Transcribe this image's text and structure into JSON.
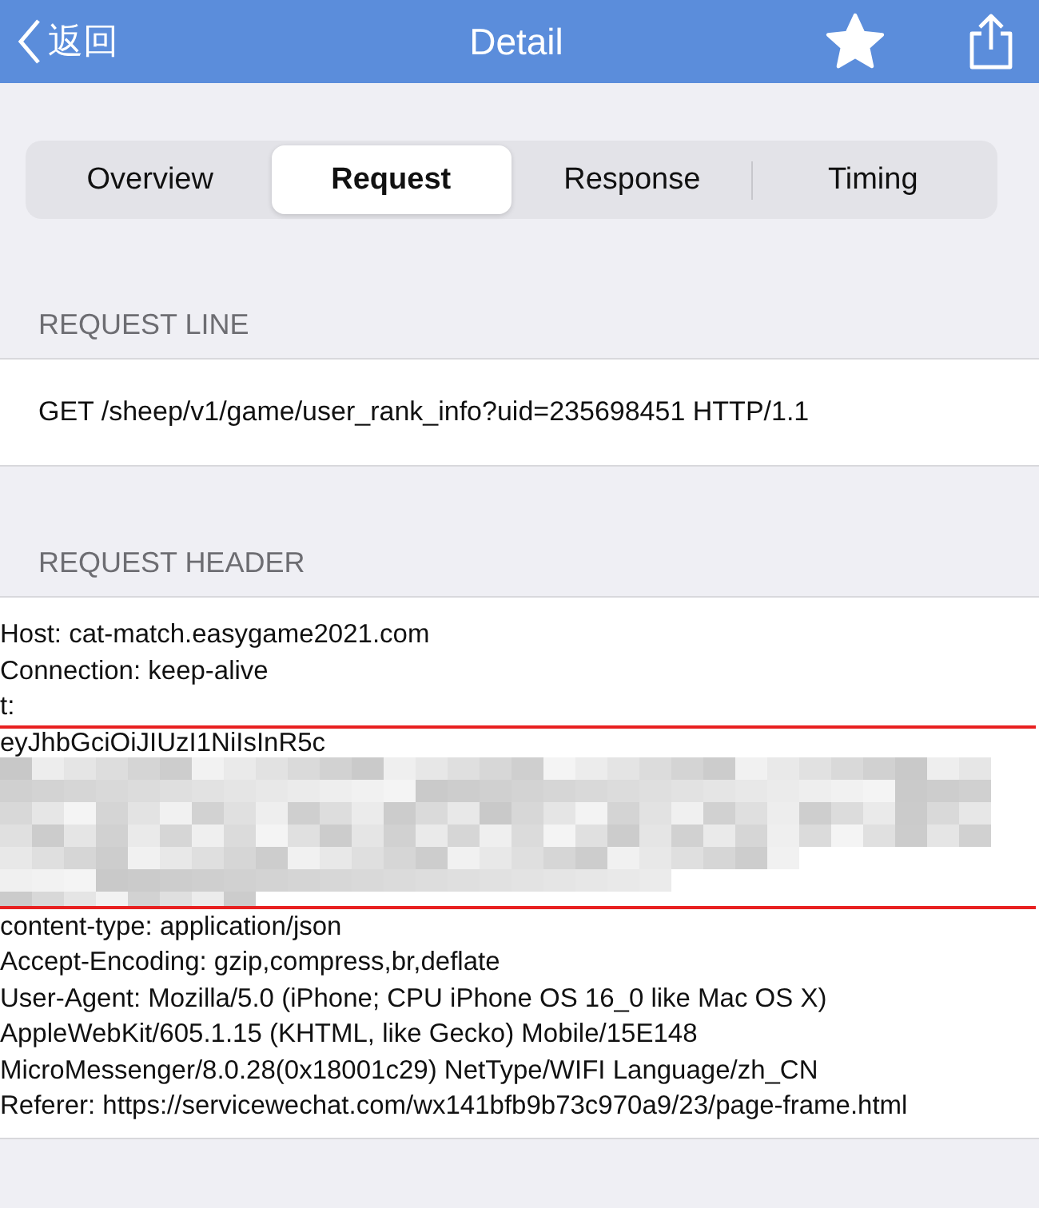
{
  "nav_bar": {
    "back_label": "返回",
    "title": "Detail",
    "favorited": true
  },
  "segments": [
    {
      "label": "Overview",
      "selected": false
    },
    {
      "label": "Request",
      "selected": true
    },
    {
      "label": "Response",
      "selected": false
    },
    {
      "label": "Timing",
      "selected": false
    }
  ],
  "request_line": {
    "heading": "REQUEST LINE",
    "text": "GET /sheep/v1/game/user_rank_info?uid=235698451 HTTP/1.1"
  },
  "request_header": {
    "heading": "REQUEST HEADER",
    "lines_before": [
      "Host: cat-match.easygame2021.com",
      "Connection: keep-alive",
      "t:"
    ],
    "token_fragment": "eyJhbGciOiJIUzI1NiIsInR5c",
    "lines_after": [
      "content-type: application/json",
      "Accept-Encoding: gzip,compress,br,deflate",
      "User-Agent: Mozilla/5.0 (iPhone; CPU iPhone OS 16_0 like Mac OS X)",
      "AppleWebKit/605.1.15 (KHTML, like Gecko) Mobile/15E148",
      "MicroMessenger/8.0.28(0x18001c29) NetType/WIFI Language/zh_CN",
      "Referer: https://servicewechat.com/wx141bfb9b73c970a9/23/page-frame.html"
    ]
  }
}
